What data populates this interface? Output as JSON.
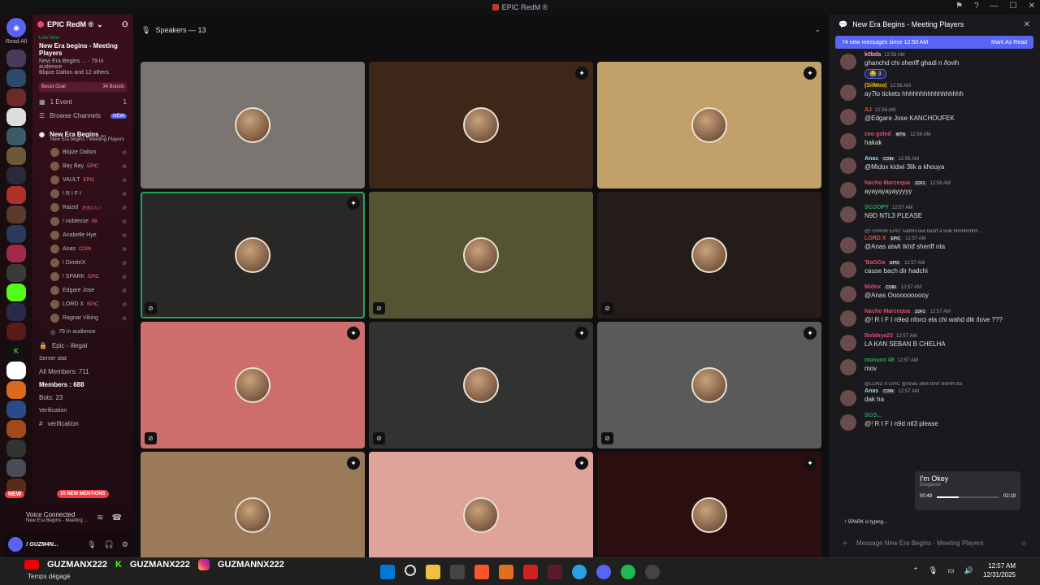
{
  "app": {
    "title": "EPIC RedM ®"
  },
  "servers": {
    "read_all": "Read All",
    "dm_badge": "11",
    "new_badge": "NEW"
  },
  "sidebar": {
    "guild_name": "EPIC RedM ®",
    "live_label": "Live Now",
    "live_title": "New Era begins - Meeting Players",
    "live_meta": "New Era Begins ... · 79 in audience",
    "live_others": "Blqize Dalton and 12 others",
    "boost_goal": "Boost Goal",
    "boost_count": "34 Boosts",
    "events": "1 Event",
    "events_count": "1",
    "browse": "Browse Channels",
    "browse_badge": "NEW",
    "stage_name": "New Era Begins ...",
    "stage_topic": "New Era begins - Meeting Players",
    "voice_users": [
      {
        "name": "Blqize Dalton",
        "tag": ""
      },
      {
        "name": "Bay Bay",
        "tag": "EPIC"
      },
      {
        "name": "VAULT",
        "tag": "EPIC"
      },
      {
        "name": "! R I F I",
        "tag": ""
      },
      {
        "name": "Raizel",
        "tag": "かわいい"
      },
      {
        "name": "! noblesse",
        "tag": "08"
      },
      {
        "name": "Anabelle Hye",
        "tag": ""
      },
      {
        "name": "Anas",
        "tag": "COIN"
      },
      {
        "name": "! DimitriX",
        "tag": ""
      },
      {
        "name": "! SPARK",
        "tag": "EPIC"
      },
      {
        "name": "Edgare Jose",
        "tag": ""
      },
      {
        "name": "LORD X",
        "tag": "EPIC"
      },
      {
        "name": "Ragnar Viking",
        "tag": ""
      }
    ],
    "audience": "79 in audience",
    "epic_illegal": "Epic - illegal",
    "server_stat": "Server stat",
    "all_members": "All Members: 711",
    "members": "Members : 688",
    "bots": "Bots: 23",
    "verification_cat": "Verification",
    "verification": "verification",
    "new_mentions": "10 NEW MENTIONS"
  },
  "voice": {
    "status": "Voice Connected",
    "channel": "New Era Begins - Meeting ..."
  },
  "user": {
    "name": "! GUZM4N..."
  },
  "stage": {
    "speakers_label": "Speakers — 13"
  },
  "tiles": [
    {
      "bg": "#7a7570",
      "badge": false,
      "muted": false
    },
    {
      "bg": "#3d2718",
      "badge": true,
      "muted": false
    },
    {
      "bg": "#c2a06a",
      "badge": true,
      "muted": false
    },
    {
      "bg": "#2a2826",
      "badge": true,
      "muted": true,
      "speaking": true
    },
    {
      "bg": "#545433",
      "badge": false,
      "muted": true
    },
    {
      "bg": "#241c18",
      "badge": false,
      "muted": true
    },
    {
      "bg": "#cd6e6c",
      "badge": true,
      "muted": true
    },
    {
      "bg": "#303332",
      "badge": true,
      "muted": true
    },
    {
      "bg": "#5a5a5a",
      "badge": true,
      "muted": true
    },
    {
      "bg": "#9a7a58",
      "badge": true,
      "muted": false
    },
    {
      "bg": "#dea39a",
      "badge": true,
      "muted": false
    },
    {
      "bg": "#2a0e10",
      "badge": true,
      "muted": false
    }
  ],
  "chat": {
    "title": "New Era Begins - Meeting Players",
    "new_messages": "74 new messages since 12:50 AM",
    "mark_read": "Mark As Read",
    "messages": [
      {
        "name": "k0bda",
        "color": "#f0a0c0",
        "tag": "",
        "time": "12:56 AM",
        "text": "ghanchd chi sheriff ghadi n /lovih",
        "reaction": "😂 3"
      },
      {
        "name": "(SiiMoo)",
        "color": "#f1c40f",
        "tag": "",
        "time": "12:56 AM",
        "text": "ay7lo tickets hhhhhhhhhhhhhhhhh"
      },
      {
        "name": "AJ",
        "color": "#e74c3c",
        "tag": "",
        "time": "12:56 AM",
        "text": "@Edgare Jose KANCHOUFEK",
        "mention": true
      },
      {
        "name": "ceo goled",
        "color": "#e04a6d",
        "tag": "WTN",
        "time": "12:56 AM",
        "text": "hakak"
      },
      {
        "name": "Anas",
        "color": "#9ad8e8",
        "tag": "COIN",
        "time": "12:56 AM",
        "text": "@Midox  kidwi 3lik a khouya",
        "mention": true
      },
      {
        "name": "Nacho Marcequa",
        "color": "#e04a6d",
        "tag": "1OF1",
        "time": "12:56 AM",
        "text": "ayayayayayyyyy"
      },
      {
        "name": "SCOOPY",
        "color": "#23a55a",
        "tag": "",
        "time": "12:57 AM",
        "text": "N9D NTL3 PLEASE"
      },
      {
        "name": "LORD X",
        "color": "#e74c3c",
        "tag": "EPIC",
        "time": "12:57 AM",
        "text": "@Anas  atwli tkhtf sheriff nta",
        "mention": true,
        "reply": "@! SPARK  EPIC  sad9ni law ba3rf a 9olk hhhhhhhhh..."
      },
      {
        "name": "'BaGGa",
        "color": "#e04a6d",
        "tag": "EPIC",
        "time": "12:57 AM",
        "text": "cause bach dir hadchi"
      },
      {
        "name": "Midox",
        "color": "#e04a6d",
        "tag": "COIN",
        "time": "12:57 AM",
        "text": "@Anas  Ooooooooooy",
        "mention": true
      },
      {
        "name": "Nacho Marcequa",
        "color": "#e04a6d",
        "tag": "1OF1",
        "time": "12:57 AM",
        "text": "@! R I F I  n9ed nforci ela chi wahd dik /love ???",
        "mention": true
      },
      {
        "name": "Bolahya23",
        "color": "#e04a6d",
        "tag": "",
        "time": "12:57 AM",
        "text": "LA KAN SEBAN B CHELHA"
      },
      {
        "name": "monaco 48",
        "color": "#23a55a",
        "tag": "",
        "time": "12:57 AM",
        "text": "mov"
      },
      {
        "name": "Anas",
        "color": "#9ad8e8",
        "tag": "COIN",
        "time": "12:57 AM",
        "text": "dak ha",
        "reply": "@LORD X  EPIC  @Anas  atwli tkhtf sheriff nta"
      },
      {
        "name": "SCO...",
        "color": "#23a55a",
        "tag": "",
        "time": "",
        "text": "@! R I F I  n9d ntl3 please",
        "mention": true
      }
    ],
    "typing": "! SPARK is typing...",
    "input_placeholder": "Message New Era Begins - Meeting Players"
  },
  "popup": {
    "name": "I'm Okey",
    "artist": "Draganov",
    "elapsed": "00:49",
    "total": "02:19",
    "progress": 0.35
  },
  "taskbar": {
    "s1": "GUZMANX222",
    "s2": "GUZMANX222",
    "s3": "GUZMANNX222",
    "weather": "Temps dégagé",
    "time": "12:57 AM",
    "date": "12/31/2025"
  }
}
